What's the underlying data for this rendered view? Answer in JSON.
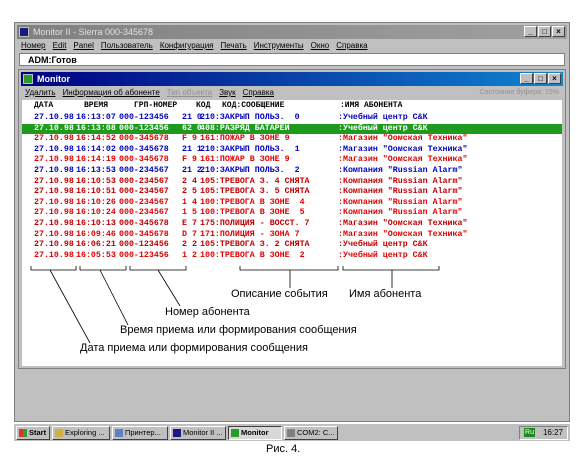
{
  "app": {
    "title": "Monitor II - Sierra  000-345678",
    "menu": [
      "Номер",
      "Edit",
      "Panel",
      "Пользователь",
      "Конфигурация",
      "Печать",
      "Инструменты",
      "Окно",
      "Справка"
    ],
    "status_line": "ADM:Готов"
  },
  "monitor": {
    "title": "Monitor",
    "menu": [
      "Удалить",
      "Информация об абоненте",
      "Тип объекта",
      "Звук",
      "Справка"
    ],
    "menu_right": "Состояние буфера: 15%",
    "columns": [
      "ДАТА",
      "ВРЕМЯ",
      "ГРП-НОМЕР",
      "КОД",
      "КОД:СООБЩЕНИЕ",
      ":ИМЯ АБОНЕНТА"
    ],
    "rows": [
      {
        "date": "27.10.98",
        "time": "16:13:07",
        "num": "000-123456",
        "code": "21 0",
        "msg": "210:ЗАКРЫП ПОЛЬЗ.  0",
        "name": ":Учебный центр С&К",
        "color": "#0000c0",
        "selected": false
      },
      {
        "date": "27.10.98",
        "time": "16:13:08",
        "num": "000-123456",
        "code": "62 0",
        "msg": "408:РАЗРЯД БАТАРЕИ",
        "name": ":Учебный центр С&К",
        "color": "#ffffff",
        "selected": true
      },
      {
        "date": "27.10.98",
        "time": "16:14:52",
        "num": "000-345678",
        "code": "F 9",
        "msg": "161:ПОЖАР В ЗОНЕ 9",
        "name": ":Магазин \"Оомская Техника\"",
        "color": "#e00000",
        "selected": false
      },
      {
        "date": "27.10.98",
        "time": "16:14:02",
        "num": "000-345678",
        "code": "21 1",
        "msg": "210:ЗАКРЫП ПОЛЬЗ.  1",
        "name": ":Магазин \"Оомская Техника\"",
        "color": "#0000c0",
        "selected": false
      },
      {
        "date": "27.10.98",
        "time": "16:14:19",
        "num": "000-345678",
        "code": "F 9",
        "msg": "161:ПОЖАР В ЗОНЕ 9",
        "name": ":Магазин \"Оомская Техника\"",
        "color": "#e00000",
        "selected": false
      },
      {
        "date": "27.10.98",
        "time": "16:13:53",
        "num": "000-234567",
        "code": "21 2",
        "msg": "210:ЗАКРЫП ПОЛЬЗ.  2",
        "name": ":Компания \"Russian Alarm\"",
        "color": "#0000c0",
        "selected": false
      },
      {
        "date": "27.10.98",
        "time": "16:10:53",
        "num": "000-234567",
        "code": "2 4",
        "msg": "105:ТРЕВОГА З. 4 СНЯТА",
        "name": ":Компания \"Russian Alarm\"",
        "color": "#c00000",
        "selected": false
      },
      {
        "date": "27.10.98",
        "time": "16:10:51",
        "num": "000-234567",
        "code": "2 5",
        "msg": "105:ТРЕВОГА З. 5 СНЯТА",
        "name": ":Компания \"Russian Alarm\"",
        "color": "#c00000",
        "selected": false
      },
      {
        "date": "27.10.98",
        "time": "16:10:26",
        "num": "000-234567",
        "code": "1 4",
        "msg": "100:ТРЕВОГА В ЗОНЕ  4",
        "name": ":Компания \"Russian Alarm\"",
        "color": "#e00000",
        "selected": false
      },
      {
        "date": "27.10.98",
        "time": "16:10:24",
        "num": "000-234567",
        "code": "1 5",
        "msg": "100:ТРЕВОГА В ЗОНЕ  5",
        "name": ":Компания \"Russian Alarm\"",
        "color": "#e00000",
        "selected": false
      },
      {
        "date": "27.10.98",
        "time": "16:10:13",
        "num": "000-345678",
        "code": "E 7",
        "msg": "175:ПОЛИЦИЯ - ВОССТ. 7",
        "name": ":Магазин \"Оомская Техника\"",
        "color": "#c00000",
        "selected": false
      },
      {
        "date": "27.10.98",
        "time": "16:09:46",
        "num": "000-345678",
        "code": "D 7",
        "msg": "171:ПОЛИЦИЯ - ЗОНА 7",
        "name": ":Магазин \"Оомская Техника\"",
        "color": "#e00000",
        "selected": false
      },
      {
        "date": "27.10.98",
        "time": "16:06:21",
        "num": "000-123456",
        "code": "2 2",
        "msg": "105:ТРЕВОГА З. 2 СНЯТА",
        "name": ":Учебный центр С&К",
        "color": "#c00000",
        "selected": false
      },
      {
        "date": "27.10.98",
        "time": "16:05:53",
        "num": "000-123456",
        "code": "1 2",
        "msg": "100:ТРЕВОГА В ЗОНЕ  2",
        "name": ":Учебный центр С&К",
        "color": "#e00000",
        "selected": false
      }
    ]
  },
  "annotations": {
    "event_desc": "Описание события",
    "subscriber_name": "Имя абонента",
    "subscriber_num": "Номер абонента",
    "time": "Время приема или формирования сообщения",
    "date": "Дата приема или формирования сообщения"
  },
  "taskbar": {
    "start": "Start",
    "items": [
      "Exploring ...",
      "Принтер...",
      "Monitor II ...",
      "Monitor",
      "COM2: C..."
    ],
    "active_index": 3,
    "lang": "Ru",
    "clock": "16:27"
  },
  "caption": "Рис. 4."
}
